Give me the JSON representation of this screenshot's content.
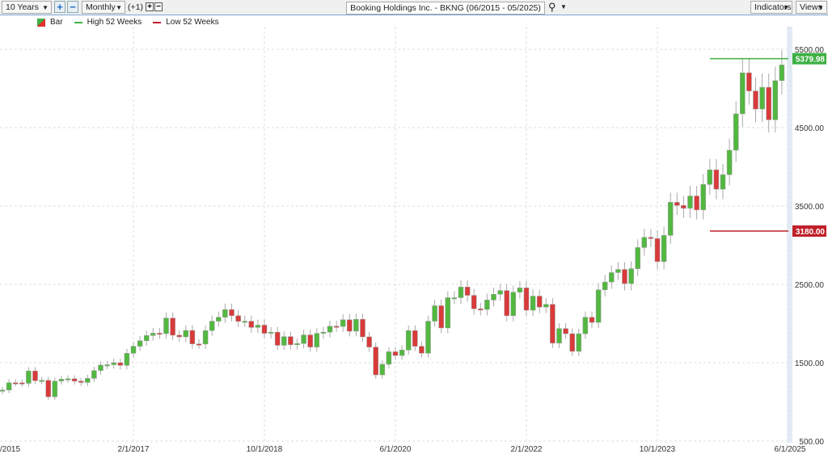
{
  "toolbar": {
    "range": "10 Years",
    "interval": "Monthly",
    "offset": "(+1)",
    "title": "Booking Holdings Inc. - BKNG (06/2015 - 05/2025)",
    "indicators": "Indicators",
    "views": "Views"
  },
  "legend": [
    {
      "label": "Bar",
      "color": "#e03030"
    },
    {
      "label": "High 52 Weeks",
      "color": "#3cb043"
    },
    {
      "label": "Low 52 Weeks",
      "color": "#c0202a"
    }
  ],
  "chart_data": {
    "type": "candlestick",
    "title": "Booking Holdings Inc. - BKNG (06/2015 - 05/2025)",
    "interval": "Monthly",
    "start": "6/2015",
    "end": "5/2025",
    "first_open": 1140,
    "wick_pct": 0.035,
    "closes": [
      1151,
      1244,
      1243,
      1237,
      1395,
      1270,
      1275,
      1065,
      1265,
      1290,
      1295,
      1265,
      1248,
      1300,
      1400,
      1470,
      1474,
      1500,
      1466,
      1620,
      1710,
      1780,
      1847,
      1877,
      1871,
      2070,
      1851,
      1830,
      1912,
      1740,
      1738,
      1910,
      2030,
      2080,
      2178,
      2100,
      2027,
      2030,
      1950,
      1980,
      1875,
      1890,
      1722,
      1833,
      1730,
      1745,
      1855,
      1700,
      1875,
      1890,
      1966,
      1963,
      2048,
      1902,
      2054,
      1830,
      1700,
      1345,
      1480,
      1640,
      1592,
      1662,
      1910,
      1710,
      1622,
      2030,
      2227,
      1944,
      2330,
      2330,
      2466,
      2360,
      2188,
      2180,
      2300,
      2374,
      2421,
      2100,
      2400,
      2455,
      2170,
      2350,
      2210,
      2245,
      1750,
      1936,
      1870,
      1645,
      1870,
      2080,
      2015,
      2430,
      2530,
      2650,
      2690,
      2510,
      2700,
      2970,
      3100,
      3084,
      2790,
      3125,
      3547,
      3507,
      3470,
      3628,
      3450,
      3775,
      3961,
      3715,
      3900,
      4212,
      4676,
      5200,
      4968,
      4737,
      5015,
      4600,
      5100,
      5300
    ],
    "up_color": "#52b840",
    "down_color": "#d93a3a",
    "y_ticks": [
      "5500.00",
      "4500.00",
      "3500.00",
      "2500.00",
      "1500.00",
      "500.00"
    ],
    "y_tick_values": [
      5500,
      4500,
      3500,
      2500,
      1500,
      500
    ],
    "ylim": [
      500,
      5500
    ],
    "x_ticks": [
      "/2015",
      "2/1/2017",
      "10/1/2018",
      "6/1/2020",
      "2/1/2022",
      "10/1/2023",
      "6/1/2025"
    ],
    "x_tick_month_index": [
      0,
      20,
      40,
      60,
      80,
      100,
      120
    ],
    "high_52w": {
      "value": 5379.98,
      "label": "5379.98"
    },
    "low_52w": {
      "value": 3180.0,
      "label": "3180.00"
    },
    "grid": true
  }
}
